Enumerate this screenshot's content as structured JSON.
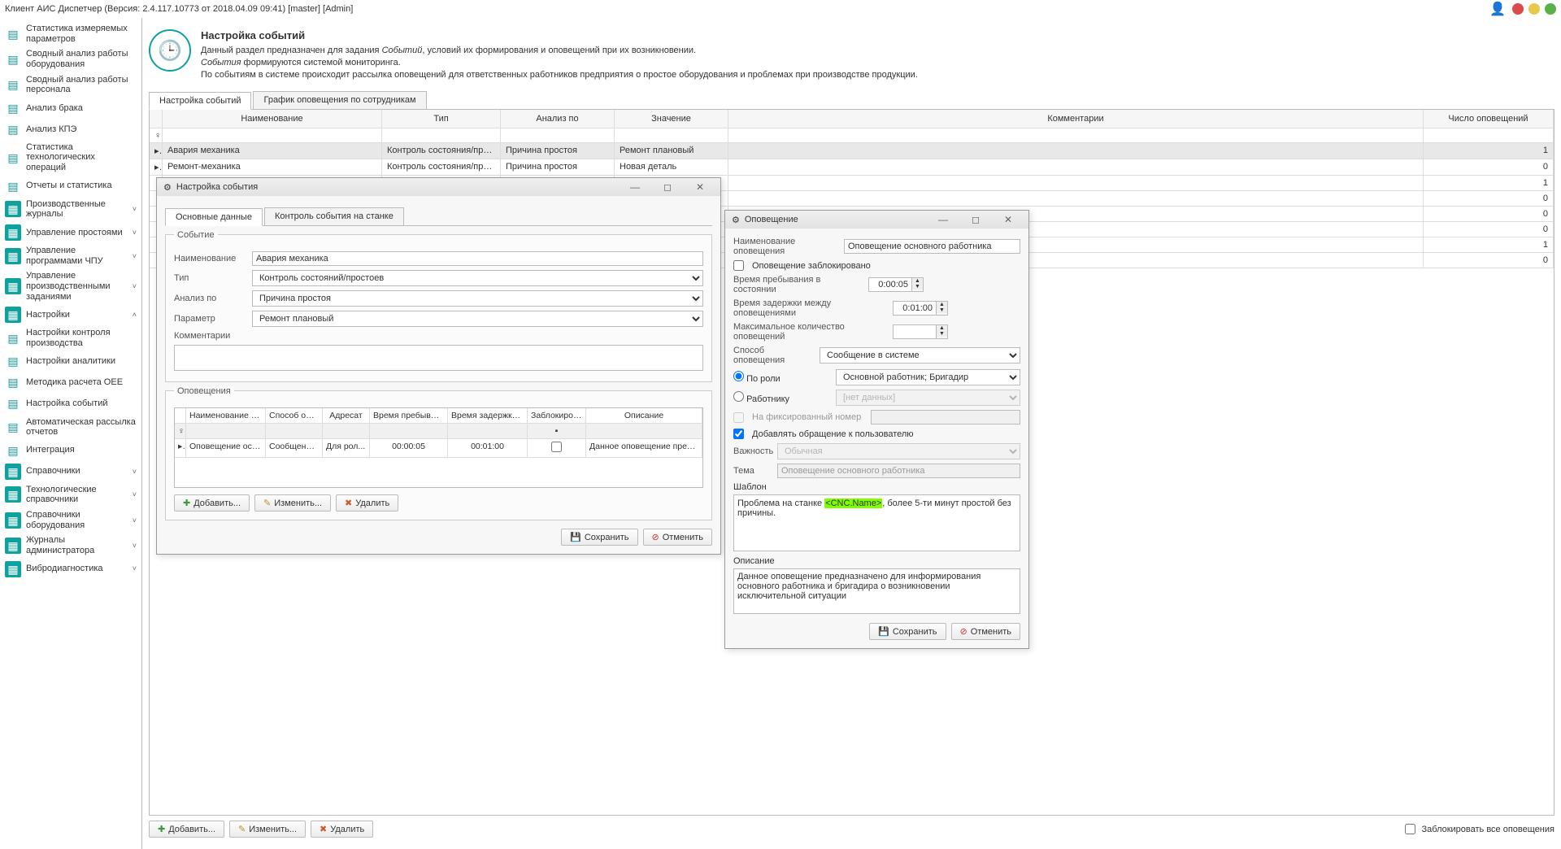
{
  "window_title": "Клиент АИС Диспетчер (Версия: 2.4.117.10773 от 2018.04.09 09:41)  [master]  [Admin]",
  "sidebar": {
    "items": [
      {
        "label": "Статистика измеряемых параметров",
        "teal": false
      },
      {
        "label": "Сводный анализ работы оборудования",
        "teal": false
      },
      {
        "label": "Сводный анализ работы персонала",
        "teal": false
      },
      {
        "label": "Анализ брака",
        "teal": false
      },
      {
        "label": "Анализ КПЭ",
        "teal": false
      },
      {
        "label": "Статистика технологических операций",
        "teal": false
      },
      {
        "label": "Отчеты и статистика",
        "teal": false
      },
      {
        "label": "Производственные журналы",
        "teal": true,
        "exp": true
      },
      {
        "label": "Управление простоями",
        "teal": true,
        "exp": true
      },
      {
        "label": "Управление программами ЧПУ",
        "teal": true,
        "exp": true
      },
      {
        "label": "Управление производственными заданиями",
        "teal": true,
        "exp": true
      },
      {
        "label": "Настройки",
        "teal": true,
        "exp": true,
        "open": true
      },
      {
        "label": "Настройки контроля производства",
        "teal": false
      },
      {
        "label": "Настройки аналитики",
        "teal": false
      },
      {
        "label": "Методика расчета OEE",
        "teal": false
      },
      {
        "label": "Настройка событий",
        "teal": false
      },
      {
        "label": "Автоматическая рассылка отчетов",
        "teal": false
      },
      {
        "label": "Интеграция",
        "teal": false
      },
      {
        "label": "Справочники",
        "teal": true,
        "exp": true
      },
      {
        "label": "Технологические справочники",
        "teal": true,
        "exp": true
      },
      {
        "label": "Справочники оборудования",
        "teal": true,
        "exp": true
      },
      {
        "label": "Журналы администратора",
        "teal": true,
        "exp": true
      },
      {
        "label": "Вибродиагностика",
        "teal": true,
        "exp": true
      }
    ]
  },
  "header": {
    "title": "Настройка событий",
    "line1_a": "Данный раздел предназначен для задания ",
    "line1_em": "Событий",
    "line1_b": ", условий их формирования и оповещений при их возникновении.",
    "line2_em": "События",
    "line2_b": " формируются системой мониторинга.",
    "line3": "По событиям в системе происходит рассылка оповещений для ответственных работников предприятия о простое оборудования и проблемах при производстве продукции."
  },
  "tabs": {
    "t1": "Настройка событий",
    "t2": "График оповещения по сотрудникам"
  },
  "grid": {
    "cols": {
      "name": "Наименование",
      "type": "Тип",
      "anal": "Анализ по",
      "val": "Значение",
      "comm": "Комментарии",
      "cnt": "Число оповещений"
    },
    "rows": [
      {
        "name": "Авария механика",
        "type": "Контроль состояния/причины п...",
        "anal": "Причина простоя",
        "val": "Ремонт плановый",
        "comm": "",
        "cnt": "1",
        "sel": true
      },
      {
        "name": "Ремонт-механика",
        "type": "Контроль состояния/причины п...",
        "anal": "Причина простоя",
        "val": "Новая деталь",
        "comm": "",
        "cnt": "0"
      },
      {
        "name": "",
        "type": "",
        "anal": "",
        "val": "",
        "comm": "",
        "cnt": "1"
      },
      {
        "name": "",
        "type": "",
        "anal": "",
        "val": "",
        "comm": "",
        "cnt": "0"
      },
      {
        "name": "",
        "type": "",
        "anal": "",
        "val": "",
        "comm": "",
        "cnt": "0"
      },
      {
        "name": "",
        "type": "",
        "anal": "",
        "val": "",
        "comm": "",
        "cnt": "0"
      },
      {
        "name": "",
        "type": "",
        "anal": "",
        "val": "",
        "comm": "",
        "cnt": "1"
      },
      {
        "name": "",
        "type": "",
        "anal": "",
        "val": "",
        "comm": "",
        "cnt": "0"
      }
    ]
  },
  "buttons": {
    "add": "Добавить...",
    "edit": "Изменить...",
    "del": "Удалить",
    "save": "Сохранить",
    "cancel": "Отменить"
  },
  "footer_check": "Заблокировать все оповещения",
  "dlg1": {
    "title": "Настройка события",
    "tab1": "Основные данные",
    "tab2": "Контроль события на станке",
    "fs1": "Событие",
    "fs2": "Оповещения",
    "f_name": "Наименование",
    "v_name": "Авария механика",
    "f_type": "Тип",
    "v_type": "Контроль состояний/простоев",
    "f_anal": "Анализ по",
    "v_anal": "Причина простоя",
    "f_param": "Параметр",
    "v_param": "Ремонт плановый",
    "f_comm": "Комментарии",
    "ig_cols": {
      "c2": "Наименование оповещения",
      "c3": "Способ оповещения",
      "c4": "Адресат",
      "c5": "Время пребывания в состоянии",
      "c6": "Время задержки между оповещениями",
      "c7": "Заблокировано",
      "c8": "Описание"
    },
    "ig_row": {
      "c2": "Оповещение основ...",
      "c3": "Сообщение в ...",
      "c4": "Для рол...",
      "c5": "00:00:05",
      "c6": "00:01:00",
      "c7": "",
      "c8": "Данное оповещение предназн..."
    }
  },
  "dlg2": {
    "title": "Оповещение",
    "f_name": "Наименование оповещения",
    "v_name": "Оповещение основного работника",
    "f_block": "Оповещение заблокировано",
    "f_stay": "Время пребывания в состоянии",
    "v_stay": "0:00:05",
    "f_delay": "Время задержки между оповещениями",
    "v_delay": "0:01:00",
    "f_max": "Максимальное количество оповещений",
    "f_method": "Способ оповещения",
    "v_method": "Сообщение в системе",
    "r_role": "По роли",
    "v_role": "Основной работник; Бригадир",
    "r_worker": "Работнику",
    "v_worker": "[нет данных]",
    "f_fixed": "На фиксированный номер",
    "f_adduser": "Добавлять обращение к пользователю",
    "f_importance": "Важность",
    "v_importance": "Обычная",
    "f_theme": "Тема",
    "v_theme": "Оповещение основного работника",
    "f_tpl": "Шаблон",
    "tpl_a": "Проблема на станке ",
    "tpl_hi": "<CNC.Name>",
    "tpl_b": ", более 5-ти минут простой без причины.",
    "f_desc": "Описание",
    "v_desc": "Данное оповещение предназначено для информирования основного работника и бригадира о возникновении исключительной ситуации"
  }
}
